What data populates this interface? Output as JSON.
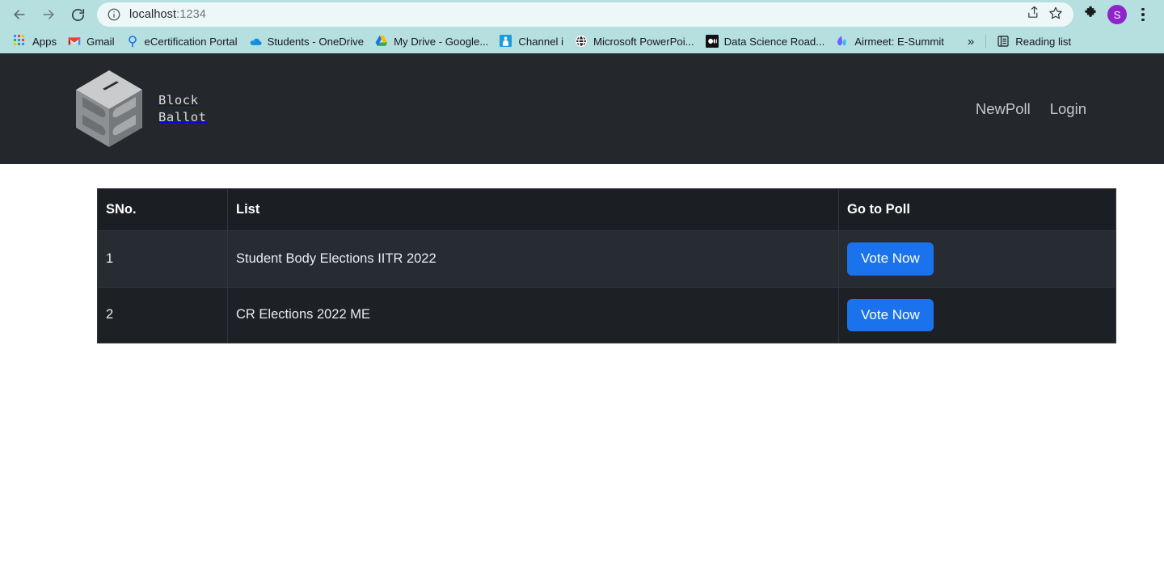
{
  "browser": {
    "back_icon": "back-arrow-icon",
    "forward_icon": "forward-arrow-icon",
    "reload_icon": "reload-icon",
    "site_info_icon": "site-info-icon",
    "url_host": "localhost",
    "url_port": ":1234",
    "url_full": "localhost:1234",
    "share_icon": "share-icon",
    "bookmark_star_icon": "star-icon",
    "extensions_icon": "puzzle-piece-icon",
    "profile_initial": "S",
    "menu_icon": "three-dot-menu-icon",
    "bookmarks": [
      {
        "label": "Apps",
        "icon": "apps-grid-icon"
      },
      {
        "label": "Gmail",
        "icon": "gmail-icon"
      },
      {
        "label": "eCertification Portal",
        "icon": "ecertification-icon"
      },
      {
        "label": "Students - OneDrive",
        "icon": "onedrive-icon"
      },
      {
        "label": "My Drive - Google...",
        "icon": "google-drive-icon"
      },
      {
        "label": "Channel i",
        "icon": "channel-i-icon"
      },
      {
        "label": "Microsoft PowerPoi...",
        "icon": "powerpoint-globe-icon"
      },
      {
        "label": "Data Science Road...",
        "icon": "medium-icon"
      },
      {
        "label": "Airmeet: E-Summit",
        "icon": "airmeet-icon"
      }
    ],
    "overflow_label": "»",
    "reading_list_label": "Reading list",
    "reading_list_icon": "reading-list-icon"
  },
  "site": {
    "brand": {
      "logo_icon": "ballot-box-cube-logo",
      "line1": "Block",
      "line2": "Ballot"
    },
    "nav": [
      {
        "label": "NewPoll"
      },
      {
        "label": "Login"
      }
    ]
  },
  "table": {
    "headers": [
      "SNo.",
      "List",
      "Go to Poll"
    ],
    "rows": [
      {
        "sno": "1",
        "list": "Student Body Elections IITR 2022",
        "action": "Vote Now"
      },
      {
        "sno": "2",
        "list": "CR Elections 2022 ME",
        "action": "Vote Now"
      }
    ]
  },
  "colors": {
    "chrome_bg": "#b6dfe0",
    "omnibox_bg": "#eef7f7",
    "header_bg": "#24272c",
    "table_header_bg": "#1b1e23",
    "row_odd_bg": "#272b32",
    "row_even_bg": "#1d2025",
    "button_blue": "#1a73ed",
    "avatar_purple": "#8e24c9"
  }
}
